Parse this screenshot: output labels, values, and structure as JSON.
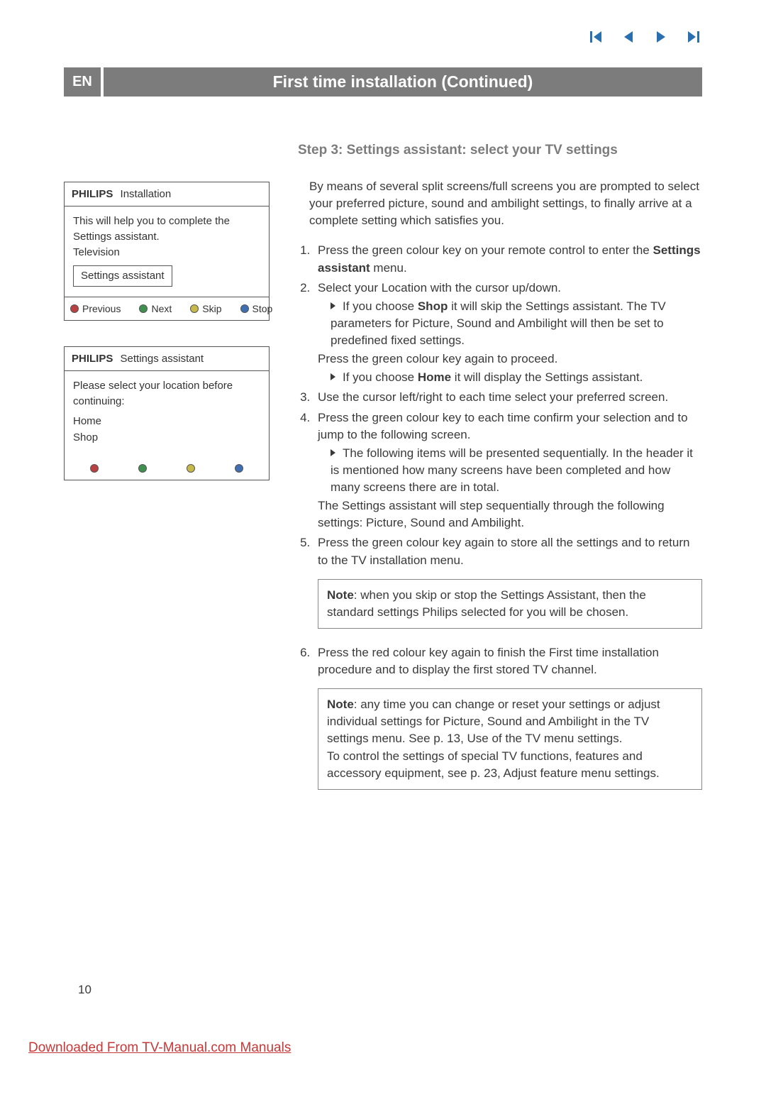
{
  "lang_badge": "EN",
  "title": "First time installation  (Continued)",
  "nav_icons": {
    "first": "first-icon",
    "prev": "prev-icon",
    "next": "next-icon",
    "last": "last-icon"
  },
  "diagram1": {
    "brand": "PHILIPS",
    "title": "Installation",
    "line1": "This will help you to complete the Settings assistant.",
    "line2": "Television",
    "button": "Settings assistant",
    "footer": {
      "red": "Previous",
      "green": "Next",
      "yellow": "Skip",
      "blue": "Stop"
    }
  },
  "diagram2": {
    "brand": "PHILIPS",
    "title": "Settings assistant",
    "prompt": "Please select your location before continuing:",
    "opt1": "Home",
    "opt2": "Shop"
  },
  "step_heading": "Step 3: Settings assistant: select your TV settings",
  "intro": "By means of several split screens/full screens you are prompted to select your preferred picture, sound and ambilight settings, to finally arrive at a complete setting which satisfies you.",
  "li1_a": "Press the green colour key on your remote control to enter the ",
  "li1_b_bold": "Settings assistant",
  "li1_c": " menu.",
  "li2": "Select your Location with the cursor up/down.",
  "li2_sub1_a": "If you choose ",
  "li2_sub1_b_bold": "Shop",
  "li2_sub1_c": " it will skip the Settings assistant. The TV parameters for Picture, Sound and Ambilight will then be set to predefined fixed settings.",
  "li2_after": "Press the green colour key again to proceed.",
  "li2_sub2_a": "If you choose ",
  "li2_sub2_b_bold": "Home",
  "li2_sub2_c": " it will display the Settings assistant.",
  "li3": "Use the cursor left/right to each time select your preferred screen.",
  "li4": "Press the green colour key to each time confirm your selection and to jump to the following screen.",
  "li4_sub1": "The following items will be presented sequentially. In the header it is mentioned how many screens have been completed and how many screens there are in total.",
  "li4_after": "The Settings assistant will step sequentially through the following settings: Picture, Sound and Ambilight.",
  "li5": "Press the green colour key again to store all the settings and to return to the TV installation menu.",
  "note1_a_bold": "Note",
  "note1_b": ": when you skip or stop the Settings Assistant, then the standard settings Philips selected for you will be chosen.",
  "li6": "Press the red colour key again to finish the First time installation procedure and to display the first stored TV channel.",
  "note2_a_bold": "Note",
  "note2_b": ": any time you can change or reset your settings or adjust individual settings for Picture, Sound and Ambilight in the TV settings menu. See p. 13, Use of the TV menu settings.",
  "note2_c": "To control the settings of special TV functions, features and accessory equipment, see p. 23,  Adjust feature menu settings.",
  "page_number": "10",
  "footer_link": "Downloaded From TV-Manual.com Manuals"
}
